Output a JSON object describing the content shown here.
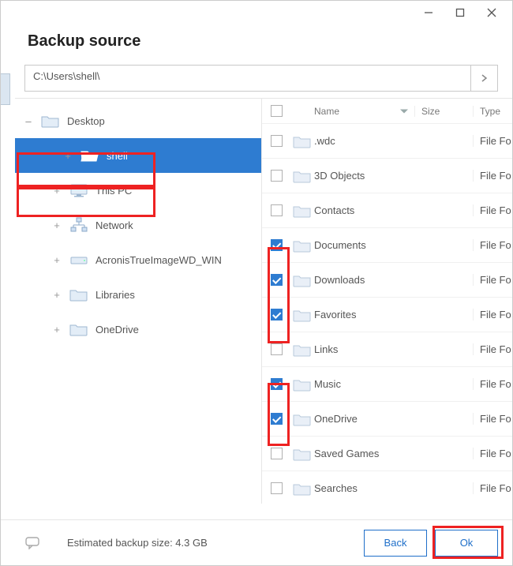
{
  "window": {
    "title": "Backup source"
  },
  "path": "C:\\Users\\shell\\",
  "tree": [
    {
      "label": "Desktop",
      "depth": 1,
      "icon": "folder",
      "expander": "minus",
      "selected": false
    },
    {
      "label": "shell",
      "depth": 2,
      "icon": "folder-open",
      "expander": "plus",
      "selected": true
    },
    {
      "label": "This PC",
      "depth": 2,
      "icon": "monitor",
      "expander": "plus",
      "selected": false
    },
    {
      "label": "Network",
      "depth": 2,
      "icon": "network",
      "expander": "plus",
      "selected": false
    },
    {
      "label": "AcronisTrueImageWD_WIN",
      "depth": 2,
      "icon": "drive",
      "expander": "plus",
      "selected": false
    },
    {
      "label": "Libraries",
      "depth": 2,
      "icon": "folder",
      "expander": "plus",
      "selected": false
    },
    {
      "label": "OneDrive",
      "depth": 2,
      "icon": "folder",
      "expander": "plus",
      "selected": false
    }
  ],
  "list": {
    "headers": {
      "name": "Name",
      "size": "Size",
      "type": "Type"
    },
    "rows": [
      {
        "name": ".wdc",
        "type": "File Fo",
        "checked": false
      },
      {
        "name": "3D Objects",
        "type": "File Fo",
        "checked": false
      },
      {
        "name": "Contacts",
        "type": "File Fo",
        "checked": false
      },
      {
        "name": "Documents",
        "type": "File Fo",
        "checked": true
      },
      {
        "name": "Downloads",
        "type": "File Fo",
        "checked": true
      },
      {
        "name": "Favorites",
        "type": "File Fo",
        "checked": true
      },
      {
        "name": "Links",
        "type": "File Fo",
        "checked": false
      },
      {
        "name": "Music",
        "type": "File Fo",
        "checked": true
      },
      {
        "name": "OneDrive",
        "type": "File Fo",
        "checked": true
      },
      {
        "name": "Saved Games",
        "type": "File Fo",
        "checked": false
      },
      {
        "name": "Searches",
        "type": "File Fo",
        "checked": false
      }
    ]
  },
  "footer": {
    "estimated": "Estimated backup size: 4.3 GB",
    "back": "Back",
    "ok": "Ok"
  }
}
